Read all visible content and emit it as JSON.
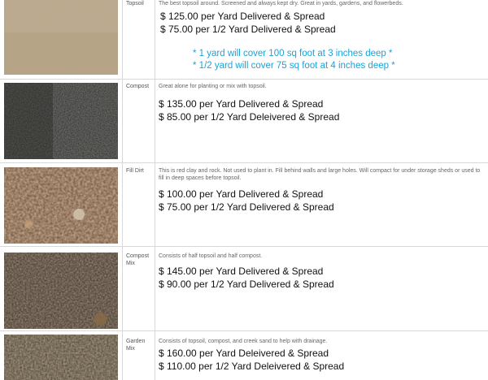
{
  "products": [
    {
      "name": "Topsoil",
      "description": "The best topsoil around. Screened and always kept dry. Great in yards, gardens, and flowerbeds.",
      "price_yard": "$ 125.00 per Yard Delivered & Spread",
      "price_half": "$ 75.00 per 1/2 Yard Delivered & Spread",
      "notes": [
        "* 1 yard will cover 100 sq foot at 3 inches deep *",
        "* 1/2 yard will cover 75 sq foot at 4 inches deep *"
      ],
      "image": "topsoil-image"
    },
    {
      "name": "Compost",
      "description": "Great alone for planting or mix with topsoil.",
      "price_yard": "$ 135.00 per Yard Delivered & Spread",
      "price_half": "$ 85.00 per 1/2 Yard Deleivered & Spread",
      "image": "compost-image"
    },
    {
      "name": "Fill Dirt",
      "description": "This is red clay and rock. Not used to plant in. Fill behind walls and large holes. Will compact for under storage sheds or used to fill in deep spaces before topsoil.",
      "price_yard": "$ 100.00 per Yard Delivered & Spread",
      "price_half": "$ 75.00 per 1/2 Yard Delivered & Spread",
      "image": "fill-dirt-image"
    },
    {
      "name": "Compost Mix",
      "description": "Consists of half topsoil and half compost.",
      "price_yard": "$ 145.00 per Yard Delivered & Spread",
      "price_half": "$ 90.00 per 1/2 Yard Delivered & Spread",
      "image": "compost-mix-image"
    },
    {
      "name": "Garden Mix",
      "description": "Consists of topsoil, compost, and creek sand to help with drainage.",
      "price_yard": "$ 160.00 per Yard Deleivered & Spread",
      "price_half": "$ 110.00 per 1/2 Yard Deleivered & Spread",
      "image": "garden-mix-image"
    }
  ],
  "colors": {
    "note_text": "#1aa3d9",
    "border": "#d8d8d8",
    "price_text": "#111111"
  }
}
